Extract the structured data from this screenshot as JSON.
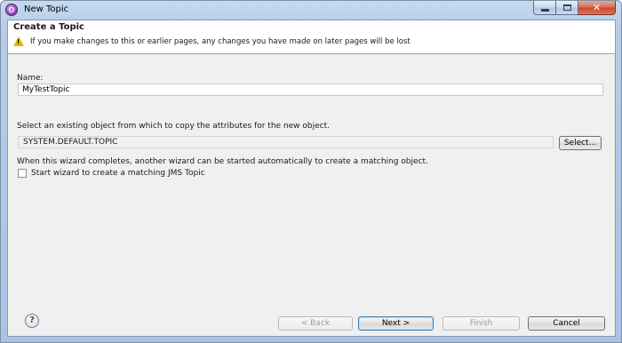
{
  "window": {
    "title": "New Topic",
    "controls": {
      "minimize": "minimize-icon",
      "maximize": "maximize-icon",
      "close": "close-icon"
    }
  },
  "banner": {
    "title": "Create a Topic",
    "message": "If you make changes to this or earlier pages, any changes you have made on later pages will be lost",
    "icon": "warning-icon"
  },
  "form": {
    "name_label": "Name:",
    "name_value": "MyTestTopic",
    "copy_label": "Select an existing object from which to copy the attributes for the new object.",
    "copy_value": "SYSTEM.DEFAULT.TOPIC",
    "select_button": "Select...",
    "wizard_label": "When this wizard completes, another wizard can be started automatically to create a matching object.",
    "checkbox_label": "Start wizard to create a matching JMS Topic",
    "checkbox_checked": false
  },
  "footer": {
    "help_icon": "help-icon",
    "back": "< Back",
    "next": "Next >",
    "finish": "Finish",
    "cancel": "Cancel"
  },
  "colors": {
    "frame": "#b5cde8",
    "close_button": "#d76d54",
    "warning": "#e8b800"
  }
}
